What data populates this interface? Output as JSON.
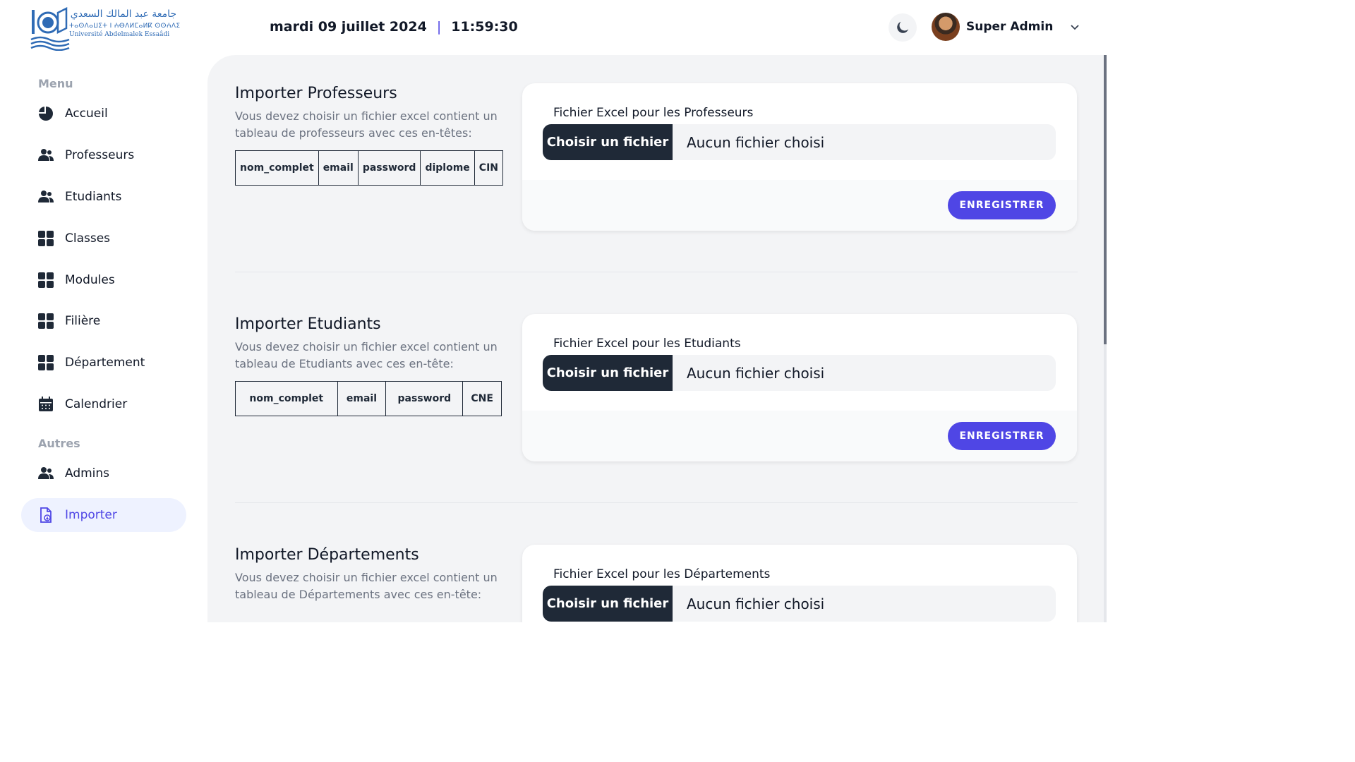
{
  "logo": {
    "arabic": "جامعة عبد المالك السعدي",
    "tifinagh": "ⵜⴰⵙⴷⴰⵡⵉⵜ ⵏ ⵄⴱⴷⵍⵎⴰⵍⴽ ⵙⵙⵄⴷⵉ",
    "latin": "Université Abdelmalek Essaâdi"
  },
  "header": {
    "date": "mardi 09 juillet 2024",
    "separator": "|",
    "time": "11:59:30",
    "user_name": "Super Admin"
  },
  "sidebar": {
    "menu_title": "Menu",
    "items": [
      {
        "label": "Accueil",
        "icon": "pie-chart-icon"
      },
      {
        "label": "Professeurs",
        "icon": "users-icon"
      },
      {
        "label": "Etudiants",
        "icon": "users-icon"
      },
      {
        "label": "Classes",
        "icon": "grid-icon"
      },
      {
        "label": "Modules",
        "icon": "grid-icon"
      },
      {
        "label": "Filière",
        "icon": "grid-icon"
      },
      {
        "label": "Département",
        "icon": "grid-icon"
      },
      {
        "label": "Calendrier",
        "icon": "calendar-icon"
      }
    ],
    "other_title": "Autres",
    "other_items": [
      {
        "label": "Admins",
        "icon": "users-icon"
      },
      {
        "label": "Importer",
        "icon": "file-import-icon",
        "active": true
      }
    ]
  },
  "sections": [
    {
      "title": "Importer Professeurs",
      "description": "Vous devez choisir un fichier excel contient un tableau de professeurs avec ces en-têtes:",
      "columns": [
        "nom_complet",
        "email",
        "password",
        "diplome",
        "CIN"
      ],
      "card_label": "Fichier Excel pour les Professeurs",
      "choose_label": "Choisir un fichier",
      "no_file": "Aucun fichier choisi",
      "save_label": "ENREGISTRER"
    },
    {
      "title": "Importer Etudiants",
      "description": "Vous devez choisir un fichier excel contient un tableau de Etudiants avec ces en-tête:",
      "columns": [
        "nom_complet",
        "email",
        "password",
        "CNE"
      ],
      "card_label": "Fichier Excel pour les Etudiants",
      "choose_label": "Choisir un fichier",
      "no_file": "Aucun fichier choisi",
      "save_label": "ENREGISTRER"
    },
    {
      "title": "Importer Départements",
      "description": "Vous devez choisir un fichier excel contient un tableau de Départements avec ces en-tête:",
      "card_label": "Fichier Excel pour les Départements",
      "choose_label": "Choisir un fichier",
      "no_file": "Aucun fichier choisi"
    }
  ],
  "colors": {
    "accent": "#4f46e5",
    "dark": "#1f2937",
    "main_bg": "#f3f4f6",
    "logo_blue": "#2f6bb5"
  }
}
